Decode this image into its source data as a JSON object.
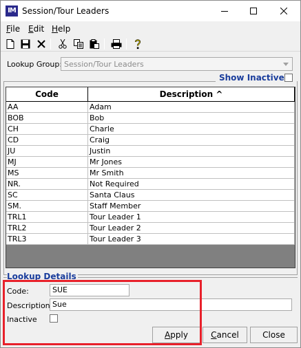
{
  "window": {
    "app_icon_text": "IM",
    "title": "Session/Tour Leaders"
  },
  "menu": {
    "items": [
      {
        "label": "File",
        "underline": "F",
        "rest": "ile"
      },
      {
        "label": "Edit",
        "underline": "E",
        "rest": "dit"
      },
      {
        "label": "Help",
        "underline": "H",
        "rest": "elp"
      }
    ]
  },
  "toolbar": {
    "icons": [
      "new-icon",
      "save-icon",
      "delete-icon",
      "cut-icon",
      "copy-icon",
      "paste-icon",
      "print-icon",
      "help-icon"
    ]
  },
  "lookup_group": {
    "label": "Lookup Group:",
    "value": "Session/Tour Leaders"
  },
  "show_inactive": {
    "label": "Show Inactive",
    "checked": false
  },
  "grid": {
    "columns": [
      "Code",
      "Description ^"
    ],
    "rows": [
      {
        "code": "AA",
        "description": "Adam"
      },
      {
        "code": "BOB",
        "description": "Bob"
      },
      {
        "code": "CH",
        "description": "Charle"
      },
      {
        "code": "CD",
        "description": "Craig"
      },
      {
        "code": "JU",
        "description": "Justin"
      },
      {
        "code": "MJ",
        "description": "Mr Jones"
      },
      {
        "code": "MS",
        "description": "Mr Smith"
      },
      {
        "code": "NR.",
        "description": "Not Required"
      },
      {
        "code": "SC",
        "description": "Santa Claus"
      },
      {
        "code": "SM.",
        "description": "Staff Member"
      },
      {
        "code": "TRL1",
        "description": "Tour Leader 1"
      },
      {
        "code": "TRL2",
        "description": "Tour Leader 2"
      },
      {
        "code": "TRL3",
        "description": "Tour Leader 3"
      }
    ]
  },
  "lookup_details": {
    "title": "Lookup Details",
    "code_label": "Code:",
    "code_value": "SUE",
    "description_label": "Description:",
    "description_value": "Sue",
    "inactive_label": "Inactive",
    "inactive_checked": false
  },
  "buttons": {
    "apply": {
      "underline": "A",
      "rest": "pply"
    },
    "cancel": {
      "underline": "C",
      "rest": "ancel"
    },
    "close": {
      "label": "Close"
    }
  },
  "colors": {
    "highlight_box": "#e8202a",
    "section_title": "#1a3d9c",
    "app_icon_bg": "#2b2a8c"
  }
}
